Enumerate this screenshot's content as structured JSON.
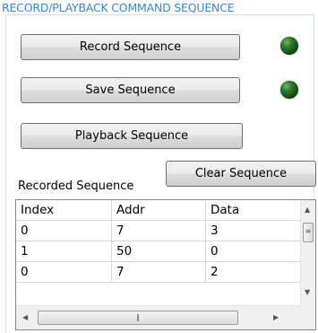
{
  "group_title": "RECORD/PLAYBACK COMMAND SEQUENCE",
  "buttons": {
    "record": "Record Sequence",
    "save": "Save Sequence",
    "playback": "Playback Sequence",
    "clear": "Clear Sequence"
  },
  "indicators": {
    "record_led_color": "#2f7a2f",
    "save_led_color": "#2f7a2f"
  },
  "recorded_label": "Recorded Sequence",
  "table": {
    "columns": [
      "Index",
      "Addr",
      "Data"
    ],
    "rows": [
      [
        "0",
        "7",
        "3"
      ],
      [
        "1",
        "50",
        "0"
      ],
      [
        "0",
        "7",
        "2"
      ]
    ]
  },
  "scrollbar_icons": {
    "up": "up-arrow-icon",
    "down": "down-arrow-icon",
    "left": "left-arrow-icon",
    "right": "right-arrow-icon",
    "thumb_grip": "grip-icon"
  }
}
